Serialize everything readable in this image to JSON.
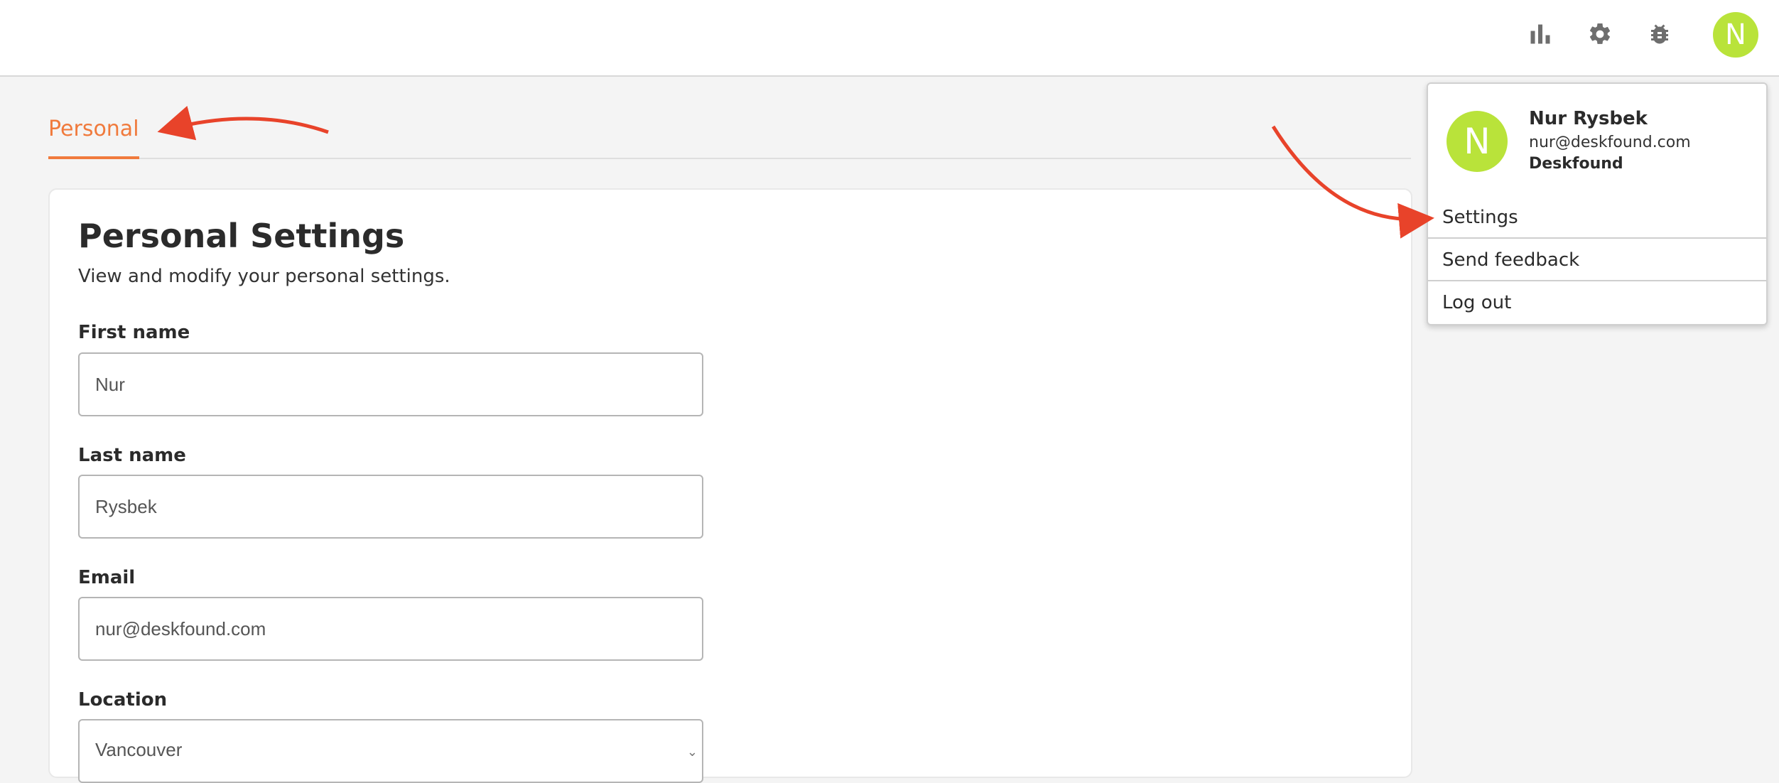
{
  "header": {
    "icons": [
      "bar-chart-icon",
      "gear-icon",
      "bug-icon"
    ],
    "avatar_initial": "N"
  },
  "tabs": [
    {
      "label": "Personal",
      "active": true
    }
  ],
  "personal_settings": {
    "title": "Personal Settings",
    "subtitle": "View and modify your personal settings.",
    "fields": {
      "first_name": {
        "label": "First name",
        "value": "Nur"
      },
      "last_name": {
        "label": "Last name",
        "value": "Rysbek"
      },
      "email": {
        "label": "Email",
        "value": "nur@deskfound.com"
      },
      "location": {
        "label": "Location",
        "value": "Vancouver"
      }
    }
  },
  "user_menu": {
    "avatar_initial": "N",
    "name": "Nur Rysbek",
    "email": "nur@deskfound.com",
    "organization": "Deskfound",
    "items": [
      "Settings",
      "Send feedback",
      "Log out"
    ]
  },
  "colors": {
    "accent": "#f07a3c",
    "avatar": "#b9e33a",
    "annotation_arrow": "#e8432a",
    "header_bg": "#ffffff",
    "page_bg": "#f4f4f4"
  }
}
